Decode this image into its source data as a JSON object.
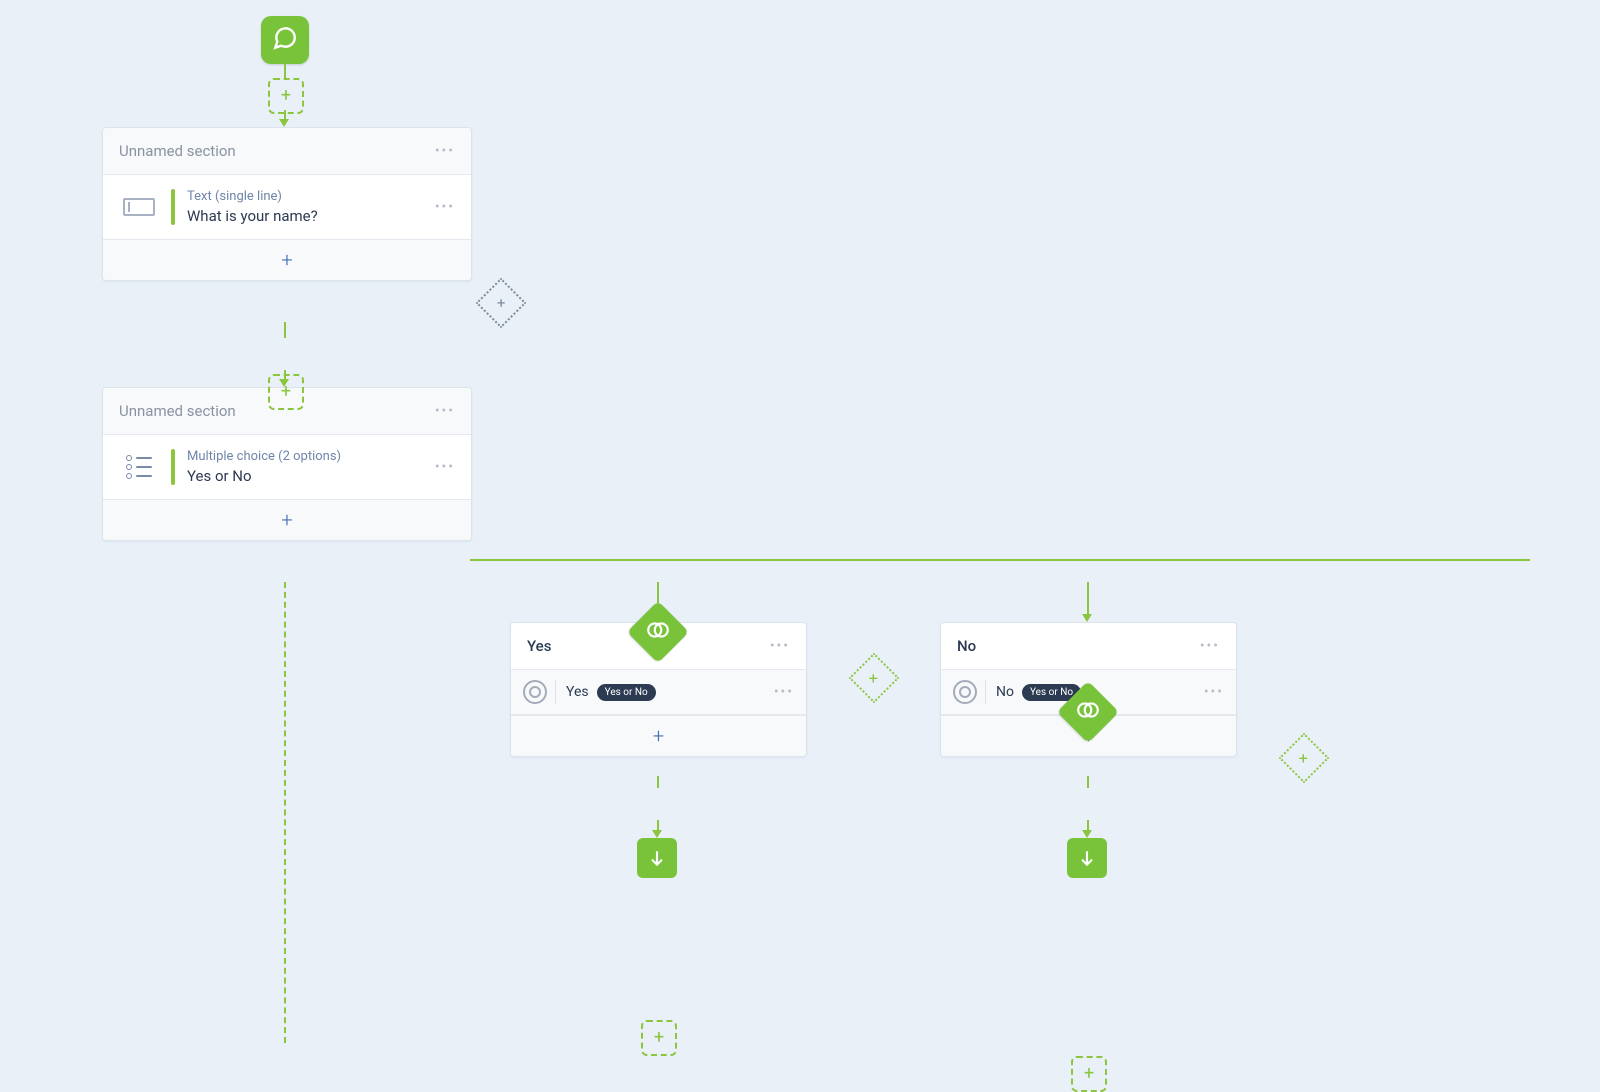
{
  "colors": {
    "accent": "#79c33b",
    "bg": "#e9f0f8"
  },
  "start": {
    "icon": "chat-icon"
  },
  "section1": {
    "title": "Unnamed section",
    "field": {
      "type_label": "Text (single line)",
      "question": "What is your name?"
    }
  },
  "section2": {
    "title": "Unnamed section",
    "field": {
      "type_label": "Multiple choice (2 options)",
      "question": "Yes or No"
    }
  },
  "branches": {
    "yes": {
      "title": "Yes",
      "option_label": "Yes",
      "source_pill": "Yes or No"
    },
    "no": {
      "title": "No",
      "option_label": "No",
      "source_pill": "Yes or No"
    }
  }
}
